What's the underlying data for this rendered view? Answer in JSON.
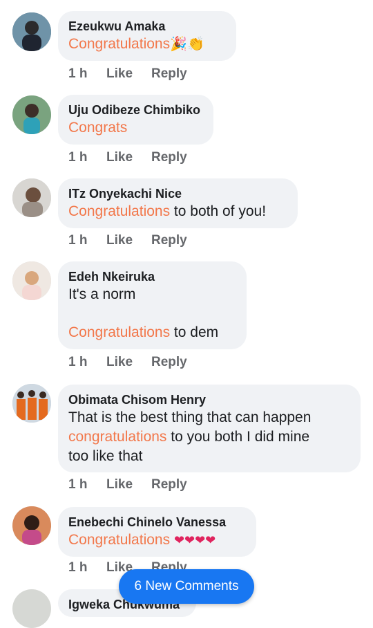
{
  "comments": [
    {
      "name": "Ezeukwu Amaka",
      "highlight": "Congratulations",
      "rest": "",
      "emoji": "🎉👏",
      "time": "1 h",
      "like": "Like",
      "reply": "Reply"
    },
    {
      "name": "Uju Odibeze Chimbiko",
      "highlight": "Congrats",
      "rest": "",
      "emoji": "",
      "time": "1 h",
      "like": "Like",
      "reply": "Reply"
    },
    {
      "name": "ITz Onyekachi Nice",
      "highlight": "Congratulations",
      "rest": " to both of you!",
      "emoji": "",
      "time": "1 h",
      "like": "Like",
      "reply": "Reply"
    },
    {
      "name": "Edeh Nkeiruka",
      "line1": "It's a norm",
      "highlight": "Congratulations",
      "rest": " to dem",
      "emoji": "",
      "time": "1 h",
      "like": "Like",
      "reply": "Reply"
    },
    {
      "name": "Obimata Chisom Henry",
      "line1": "That is the best thing that can happen",
      "highlight": "congratulations",
      "rest": " to you both I did mine",
      "line3": "too like that",
      "time": "1 h",
      "like": "Like",
      "reply": "Reply"
    },
    {
      "name": "Enebechi Chinelo Vanessa",
      "highlight": "Congratulations",
      "rest": "",
      "emoji": "❤❤❤❤",
      "time": "1 h",
      "like": "Like",
      "reply": "Reply"
    },
    {
      "name": "Igweka Chukwuma"
    }
  ],
  "new_comments_label": "6 New Comments",
  "colors": {
    "highlight": "#f2774a",
    "bubble": "#f0f2f5",
    "pill": "#1877f2",
    "meta": "#65676b"
  }
}
